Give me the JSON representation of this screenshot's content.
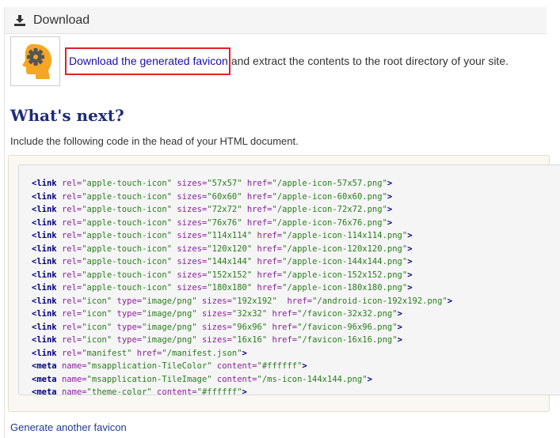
{
  "panel": {
    "title": "Download"
  },
  "download": {
    "link_text": "Download the generated favicon",
    "rest_text": "and extract the contents to the root directory of your site."
  },
  "next": {
    "heading": "What's next?",
    "intro": "Include the following code in the head of your HTML document."
  },
  "code_lines": [
    [
      [
        "tag",
        "<link "
      ],
      [
        "attr",
        "rel="
      ],
      [
        "val",
        "\"apple-touch-icon\""
      ],
      [
        "attr",
        " sizes="
      ],
      [
        "val",
        "\"57x57\""
      ],
      [
        "attr",
        " href="
      ],
      [
        "val",
        "\"/apple-icon-57x57.png\""
      ],
      [
        "tag",
        ">"
      ]
    ],
    [
      [
        "tag",
        "<link "
      ],
      [
        "attr",
        "rel="
      ],
      [
        "val",
        "\"apple-touch-icon\""
      ],
      [
        "attr",
        " sizes="
      ],
      [
        "val",
        "\"60x60\""
      ],
      [
        "attr",
        " href="
      ],
      [
        "val",
        "\"/apple-icon-60x60.png\""
      ],
      [
        "tag",
        ">"
      ]
    ],
    [
      [
        "tag",
        "<link "
      ],
      [
        "attr",
        "rel="
      ],
      [
        "val",
        "\"apple-touch-icon\""
      ],
      [
        "attr",
        " sizes="
      ],
      [
        "val",
        "\"72x72\""
      ],
      [
        "attr",
        " href="
      ],
      [
        "val",
        "\"/apple-icon-72x72.png\""
      ],
      [
        "tag",
        ">"
      ]
    ],
    [
      [
        "tag",
        "<link "
      ],
      [
        "attr",
        "rel="
      ],
      [
        "val",
        "\"apple-touch-icon\""
      ],
      [
        "attr",
        " sizes="
      ],
      [
        "val",
        "\"76x76\""
      ],
      [
        "attr",
        " href="
      ],
      [
        "val",
        "\"/apple-icon-76x76.png\""
      ],
      [
        "tag",
        ">"
      ]
    ],
    [
      [
        "tag",
        "<link "
      ],
      [
        "attr",
        "rel="
      ],
      [
        "val",
        "\"apple-touch-icon\""
      ],
      [
        "attr",
        " sizes="
      ],
      [
        "val",
        "\"114x114\""
      ],
      [
        "attr",
        " href="
      ],
      [
        "val",
        "\"/apple-icon-114x114.png\""
      ],
      [
        "tag",
        ">"
      ]
    ],
    [
      [
        "tag",
        "<link "
      ],
      [
        "attr",
        "rel="
      ],
      [
        "val",
        "\"apple-touch-icon\""
      ],
      [
        "attr",
        " sizes="
      ],
      [
        "val",
        "\"120x120\""
      ],
      [
        "attr",
        " href="
      ],
      [
        "val",
        "\"/apple-icon-120x120.png\""
      ],
      [
        "tag",
        ">"
      ]
    ],
    [
      [
        "tag",
        "<link "
      ],
      [
        "attr",
        "rel="
      ],
      [
        "val",
        "\"apple-touch-icon\""
      ],
      [
        "attr",
        " sizes="
      ],
      [
        "val",
        "\"144x144\""
      ],
      [
        "attr",
        " href="
      ],
      [
        "val",
        "\"/apple-icon-144x144.png\""
      ],
      [
        "tag",
        ">"
      ]
    ],
    [
      [
        "tag",
        "<link "
      ],
      [
        "attr",
        "rel="
      ],
      [
        "val",
        "\"apple-touch-icon\""
      ],
      [
        "attr",
        " sizes="
      ],
      [
        "val",
        "\"152x152\""
      ],
      [
        "attr",
        " href="
      ],
      [
        "val",
        "\"/apple-icon-152x152.png\""
      ],
      [
        "tag",
        ">"
      ]
    ],
    [
      [
        "tag",
        "<link "
      ],
      [
        "attr",
        "rel="
      ],
      [
        "val",
        "\"apple-touch-icon\""
      ],
      [
        "attr",
        " sizes="
      ],
      [
        "val",
        "\"180x180\""
      ],
      [
        "attr",
        " href="
      ],
      [
        "val",
        "\"/apple-icon-180x180.png\""
      ],
      [
        "tag",
        ">"
      ]
    ],
    [
      [
        "tag",
        "<link "
      ],
      [
        "attr",
        "rel="
      ],
      [
        "val",
        "\"icon\""
      ],
      [
        "attr",
        " type="
      ],
      [
        "val",
        "\"image/png\""
      ],
      [
        "attr",
        " sizes="
      ],
      [
        "val",
        "\"192x192\""
      ],
      [
        "attr",
        "  href="
      ],
      [
        "val",
        "\"/android-icon-192x192.png\""
      ],
      [
        "tag",
        ">"
      ]
    ],
    [
      [
        "tag",
        "<link "
      ],
      [
        "attr",
        "rel="
      ],
      [
        "val",
        "\"icon\""
      ],
      [
        "attr",
        " type="
      ],
      [
        "val",
        "\"image/png\""
      ],
      [
        "attr",
        " sizes="
      ],
      [
        "val",
        "\"32x32\""
      ],
      [
        "attr",
        " href="
      ],
      [
        "val",
        "\"/favicon-32x32.png\""
      ],
      [
        "tag",
        ">"
      ]
    ],
    [
      [
        "tag",
        "<link "
      ],
      [
        "attr",
        "rel="
      ],
      [
        "val",
        "\"icon\""
      ],
      [
        "attr",
        " type="
      ],
      [
        "val",
        "\"image/png\""
      ],
      [
        "attr",
        " sizes="
      ],
      [
        "val",
        "\"96x96\""
      ],
      [
        "attr",
        " href="
      ],
      [
        "val",
        "\"/favicon-96x96.png\""
      ],
      [
        "tag",
        ">"
      ]
    ],
    [
      [
        "tag",
        "<link "
      ],
      [
        "attr",
        "rel="
      ],
      [
        "val",
        "\"icon\""
      ],
      [
        "attr",
        " type="
      ],
      [
        "val",
        "\"image/png\""
      ],
      [
        "attr",
        " sizes="
      ],
      [
        "val",
        "\"16x16\""
      ],
      [
        "attr",
        " href="
      ],
      [
        "val",
        "\"/favicon-16x16.png\""
      ],
      [
        "tag",
        ">"
      ]
    ],
    [
      [
        "tag",
        "<link "
      ],
      [
        "attr",
        "rel="
      ],
      [
        "val",
        "\"manifest\""
      ],
      [
        "attr",
        " href="
      ],
      [
        "val",
        "\"/manifest.json\""
      ],
      [
        "tag",
        ">"
      ]
    ],
    [
      [
        "tag",
        "<meta "
      ],
      [
        "attr",
        "name="
      ],
      [
        "val",
        "\"msapplication-TileColor\""
      ],
      [
        "attr",
        " content="
      ],
      [
        "val",
        "\"#ffffff\""
      ],
      [
        "tag",
        ">"
      ]
    ],
    [
      [
        "tag",
        "<meta "
      ],
      [
        "attr",
        "name="
      ],
      [
        "val",
        "\"msapplication-TileImage\""
      ],
      [
        "attr",
        " content="
      ],
      [
        "val",
        "\"/ms-icon-144x144.png\""
      ],
      [
        "tag",
        ">"
      ]
    ],
    [
      [
        "tag",
        "<meta "
      ],
      [
        "attr",
        "name="
      ],
      [
        "val",
        "\"theme-color\""
      ],
      [
        "attr",
        " content="
      ],
      [
        "val",
        "\"#ffffff\""
      ],
      [
        "tag",
        ">"
      ]
    ]
  ],
  "footer": {
    "generate_link": "Generate another favicon"
  },
  "icons": {
    "header": "download-icon",
    "thumbnail": "head-gear-icon"
  },
  "colors": {
    "link": "#1a0dab",
    "highlight_border": "#e0202a",
    "heading": "#1f2b7a",
    "thumbnail_head": "#f5a623",
    "thumbnail_gear": "#545454"
  }
}
